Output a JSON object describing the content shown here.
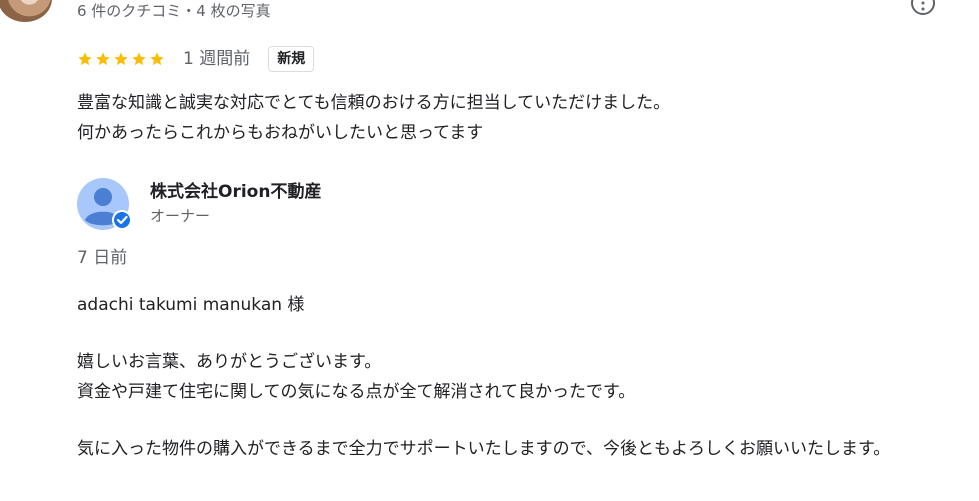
{
  "review": {
    "reviewer_meta": "6 件のクチコミ・4 枚の写真",
    "rating": 5,
    "date": "1 週間前",
    "badge": "新規",
    "text": "豊富な知識と誠実な対応でとても信頼のおける方に担当していただけました。\n何かあったらこれからもおねがいしたいと思ってます"
  },
  "owner_reply": {
    "name": "株式会社Orion不動産",
    "role": "オーナー",
    "date": "7 日前",
    "salutation": "adachi takumi manukan 様",
    "paragraph1": "嬉しいお言葉、ありがとうございます。\n資金や戸建て住宅に関しての気になる点が全て解消されて良かったです。",
    "paragraph2": "気に入った物件の購入ができるまで全力でサポートいたしますので、今後ともよろしくお願いいたします。"
  },
  "colors": {
    "star": "#fbbc04",
    "secondary_text": "#5f6368",
    "primary_text": "#202124",
    "verified": "#1a73e8",
    "avatar_bg": "#a8c7fa",
    "avatar_fg": "#4a7fd4"
  },
  "icons": {
    "more": "more-options-icon",
    "verified": "verified-check-icon",
    "star": "star-icon"
  }
}
